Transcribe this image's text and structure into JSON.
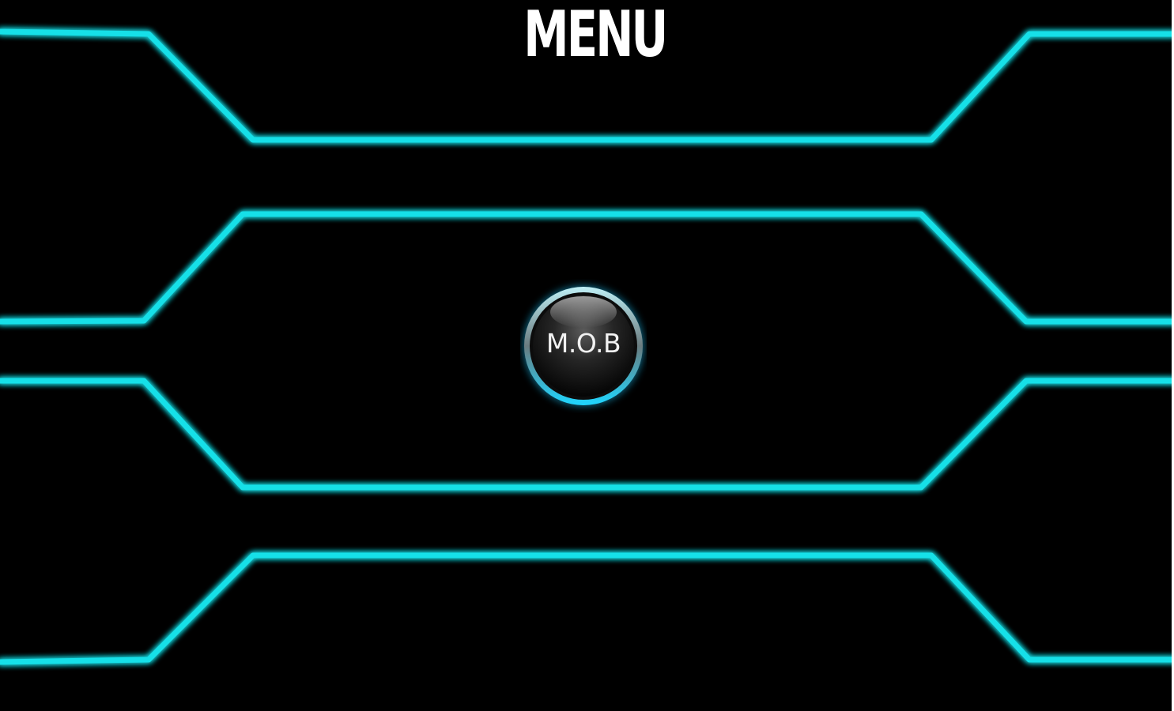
{
  "screen": {
    "title": "MENU"
  },
  "mob_button": {
    "label": "M.O.B"
  },
  "theme": {
    "background": "#000000",
    "neon_color": "#19e0e8",
    "neon_glow": "#00c8ff",
    "title_color": "#ffffff"
  }
}
